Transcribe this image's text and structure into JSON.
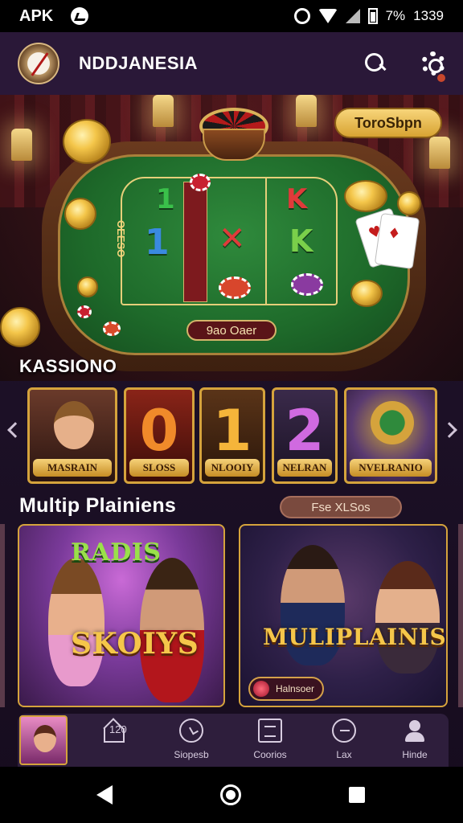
{
  "status_bar": {
    "carrier": "APK",
    "battery": "7%",
    "time": "1339"
  },
  "header": {
    "title": "NDDJANESIA"
  },
  "hero": {
    "tour_button": "ToroSbpn",
    "table_label": "9ao Oaer",
    "side_text": "OEESO",
    "symbols": [
      "1",
      "1",
      "K",
      "K"
    ]
  },
  "section_casino": {
    "title": "KASSIONO",
    "tiles": [
      {
        "label": "MASRAIN"
      },
      {
        "digit": "0",
        "label": "SLOSS"
      },
      {
        "digit": "1",
        "label": "NLOOIY"
      },
      {
        "digit": "2",
        "label": "NELRAN"
      },
      {
        "label": "NVELRANIO"
      }
    ]
  },
  "section_multi": {
    "title": "Multip Plainiens",
    "see_all": "Fse XLSos",
    "promo_left": {
      "top_text": "RADIS",
      "main_text": "SKOIYS"
    },
    "promo_right": {
      "main_text": "MULIPLAINIS",
      "button_label": "Halnsoer"
    }
  },
  "bottom_nav": {
    "items": [
      {
        "label": "",
        "count": "120",
        "icon": "home-icon"
      },
      {
        "label": "Siopesb",
        "icon": "clock-icon"
      },
      {
        "label": "Coorios",
        "icon": "doc-icon"
      },
      {
        "label": "Lax",
        "icon": "chat-icon"
      },
      {
        "label": "Hinde",
        "icon": "user-icon"
      }
    ]
  }
}
